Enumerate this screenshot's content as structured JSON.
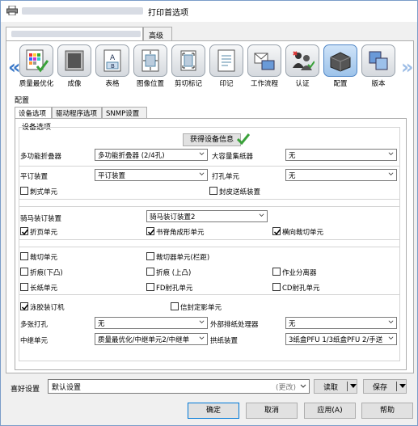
{
  "window": {
    "title": "打印首选项"
  },
  "tabs": {
    "advanced": "高级"
  },
  "toolbar": {
    "items": [
      {
        "label": "质量最优化",
        "icon": "quality-optimization-icon"
      },
      {
        "label": "成像",
        "icon": "imaging-icon"
      },
      {
        "label": "表格",
        "icon": "form-icon"
      },
      {
        "label": "图像位置",
        "icon": "image-position-icon"
      },
      {
        "label": "剪切标记",
        "icon": "trim-marks-icon"
      },
      {
        "label": "印记",
        "icon": "stamp-icon"
      },
      {
        "label": "工作流程",
        "icon": "workflow-icon"
      },
      {
        "label": "认证",
        "icon": "authentication-icon"
      },
      {
        "label": "配置",
        "icon": "configure-icon"
      },
      {
        "label": "版本",
        "icon": "version-icon"
      }
    ],
    "active": "配置"
  },
  "section": {
    "label": "配置"
  },
  "subtabs": [
    "设备选项",
    "驱动程序选项",
    "SNMP设置"
  ],
  "device_options": {
    "group_title": "设备选项",
    "get_info_button": "获得设备信息",
    "multifunction_folder": {
      "label": "多功能折叠器",
      "value": "多功能折叠器 (2/4孔)"
    },
    "large_stacker": {
      "label": "大容量集纸器",
      "value": "无"
    },
    "flat_stitcher": {
      "label": "平订装置",
      "value": "平订装置"
    },
    "punch_unit": {
      "label": "打孔单元",
      "value": "无"
    },
    "cb_crease_unit": "刺式单元",
    "cb_cover_insertion": "封皮送纸装置",
    "saddle_stitcher": {
      "label": "骑马装订装置",
      "value": "骑马装订装置2"
    },
    "cb_folding_unit": "折页单元",
    "cb_square_fold": "书脊角成形单元",
    "cb_horizontal_trim": "横向裁切单元",
    "cb_trimmer": "裁切单元",
    "cb_trimmer_gutter": "裁切器单元(栏距)",
    "cb_crease_down": "折痕(下凸)",
    "cb_crease_up": "折痕 (上凸)",
    "cb_job_separator": "作业分离器",
    "cb_long_sheet": "长纸单元",
    "cb_fd_punch": "FD射孔单元",
    "cb_cd_punch": "CD射孔单元",
    "cb_perfect_binder": "泳胶装订机",
    "cb_envelope_unit": "信封定影单元",
    "multi_punch": {
      "label": "多张打孔",
      "value": "无"
    },
    "external_processor": {
      "label": "外部排纸处理器",
      "value": "无"
    },
    "relay_unit": {
      "label": "中继单元",
      "value": "质量最优化/中继单元2/中继单"
    },
    "stacker_unit": {
      "label": "拱纸装置",
      "value": "3纸盒PFU 1/3纸盒PFU 2/手送"
    }
  },
  "checked": {
    "cb_folding_unit": true,
    "cb_square_fold": true,
    "cb_horizontal_trim": true,
    "cb_perfect_binder": true
  },
  "favorites": {
    "label": "喜好设置",
    "value": "默认设置",
    "hint": "(更改)",
    "read_button": "读取",
    "save_button": "保存"
  },
  "buttons": {
    "ok": "确定",
    "cancel": "取消",
    "apply": "应用(A)",
    "help": "帮助"
  },
  "colors": {
    "accent": "#3a78c8",
    "check_green": "#3aa13a"
  }
}
